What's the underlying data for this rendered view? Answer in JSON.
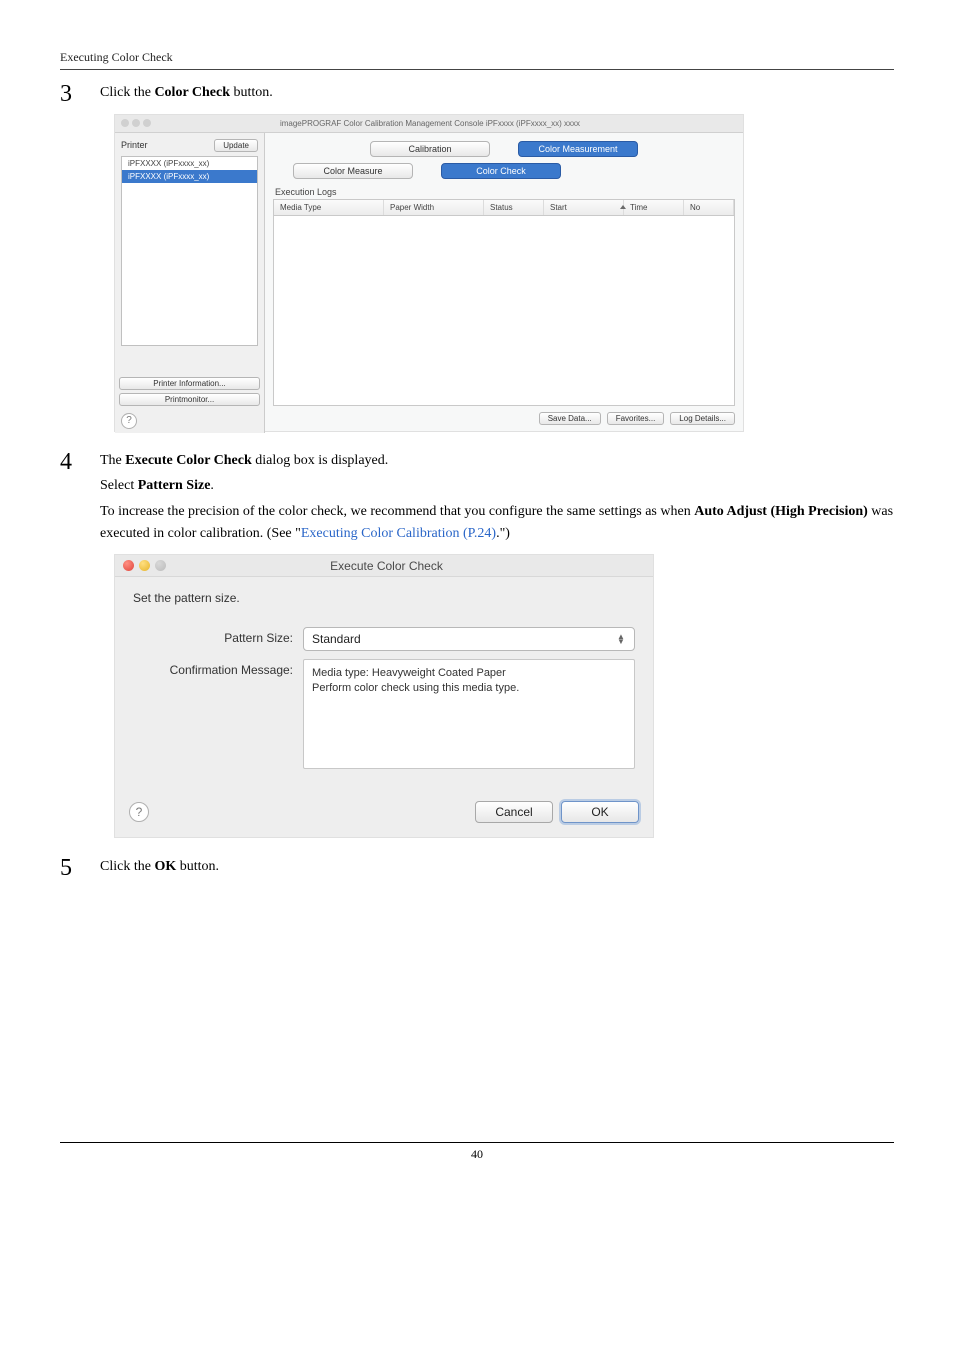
{
  "page_header": "Executing Color Check",
  "page_number": "40",
  "steps": {
    "s3": {
      "num": "3",
      "text_pre": "Click the ",
      "bold": "Color Check",
      "text_post": " button."
    },
    "s4": {
      "num": "4",
      "line1_pre": "The ",
      "line1_bold": "Execute Color Check",
      "line1_post": " dialog box is displayed.",
      "line2_pre": "Select ",
      "line2_bold": "Pattern Size",
      "line2_post": ".",
      "line3_pre": "To increase the precision of the color check, we recommend that you configure the same settings as when ",
      "line3_bold": "Auto Adjust (High Precision)",
      "line3_mid": " was executed in color calibration. (See \"",
      "line3_link": "Executing Color Calibration (P.24)",
      "line3_post": ".\")"
    },
    "s5": {
      "num": "5",
      "text_pre": "Click the ",
      "bold": "OK",
      "text_post": " button."
    }
  },
  "shot1": {
    "title": "imagePROGRAF Color Calibration Management Console iPFxxxx (iPFxxxx_xx) xxxx",
    "left": {
      "printer_label": "Printer",
      "update_label": "Update",
      "items": {
        "i0": "iPFXXXX (iPFxxxx_xx)",
        "i1": "iPFXXXX (iPFxxxx_xx)"
      },
      "printer_info": "Printer Information...",
      "printmonitor": "Printmonitor..."
    },
    "tabs1": {
      "calibration": "Calibration",
      "color_meas": "Color Measurement"
    },
    "tabs2": {
      "color_measure": "Color Measure",
      "color_check": "Color Check"
    },
    "exec_logs": "Execution Logs",
    "cols": {
      "mt": "Media Type",
      "pw": "Paper Width",
      "st": "Status",
      "start": "Start",
      "time": "Time",
      "no": "No"
    },
    "footer": {
      "save": "Save Data...",
      "fav": "Favorites...",
      "log": "Log Details..."
    },
    "help": "?"
  },
  "shot2": {
    "title": "Execute Color Check",
    "set_label": "Set the pattern size.",
    "pattern_size_k": "Pattern Size:",
    "pattern_size_v": "Standard",
    "conf_k": "Confirmation Message:",
    "conf_v1": "Media type: Heavyweight Coated Paper",
    "conf_v2": "Perform color check using this media type.",
    "help": "?",
    "cancel": "Cancel",
    "ok": "OK"
  }
}
